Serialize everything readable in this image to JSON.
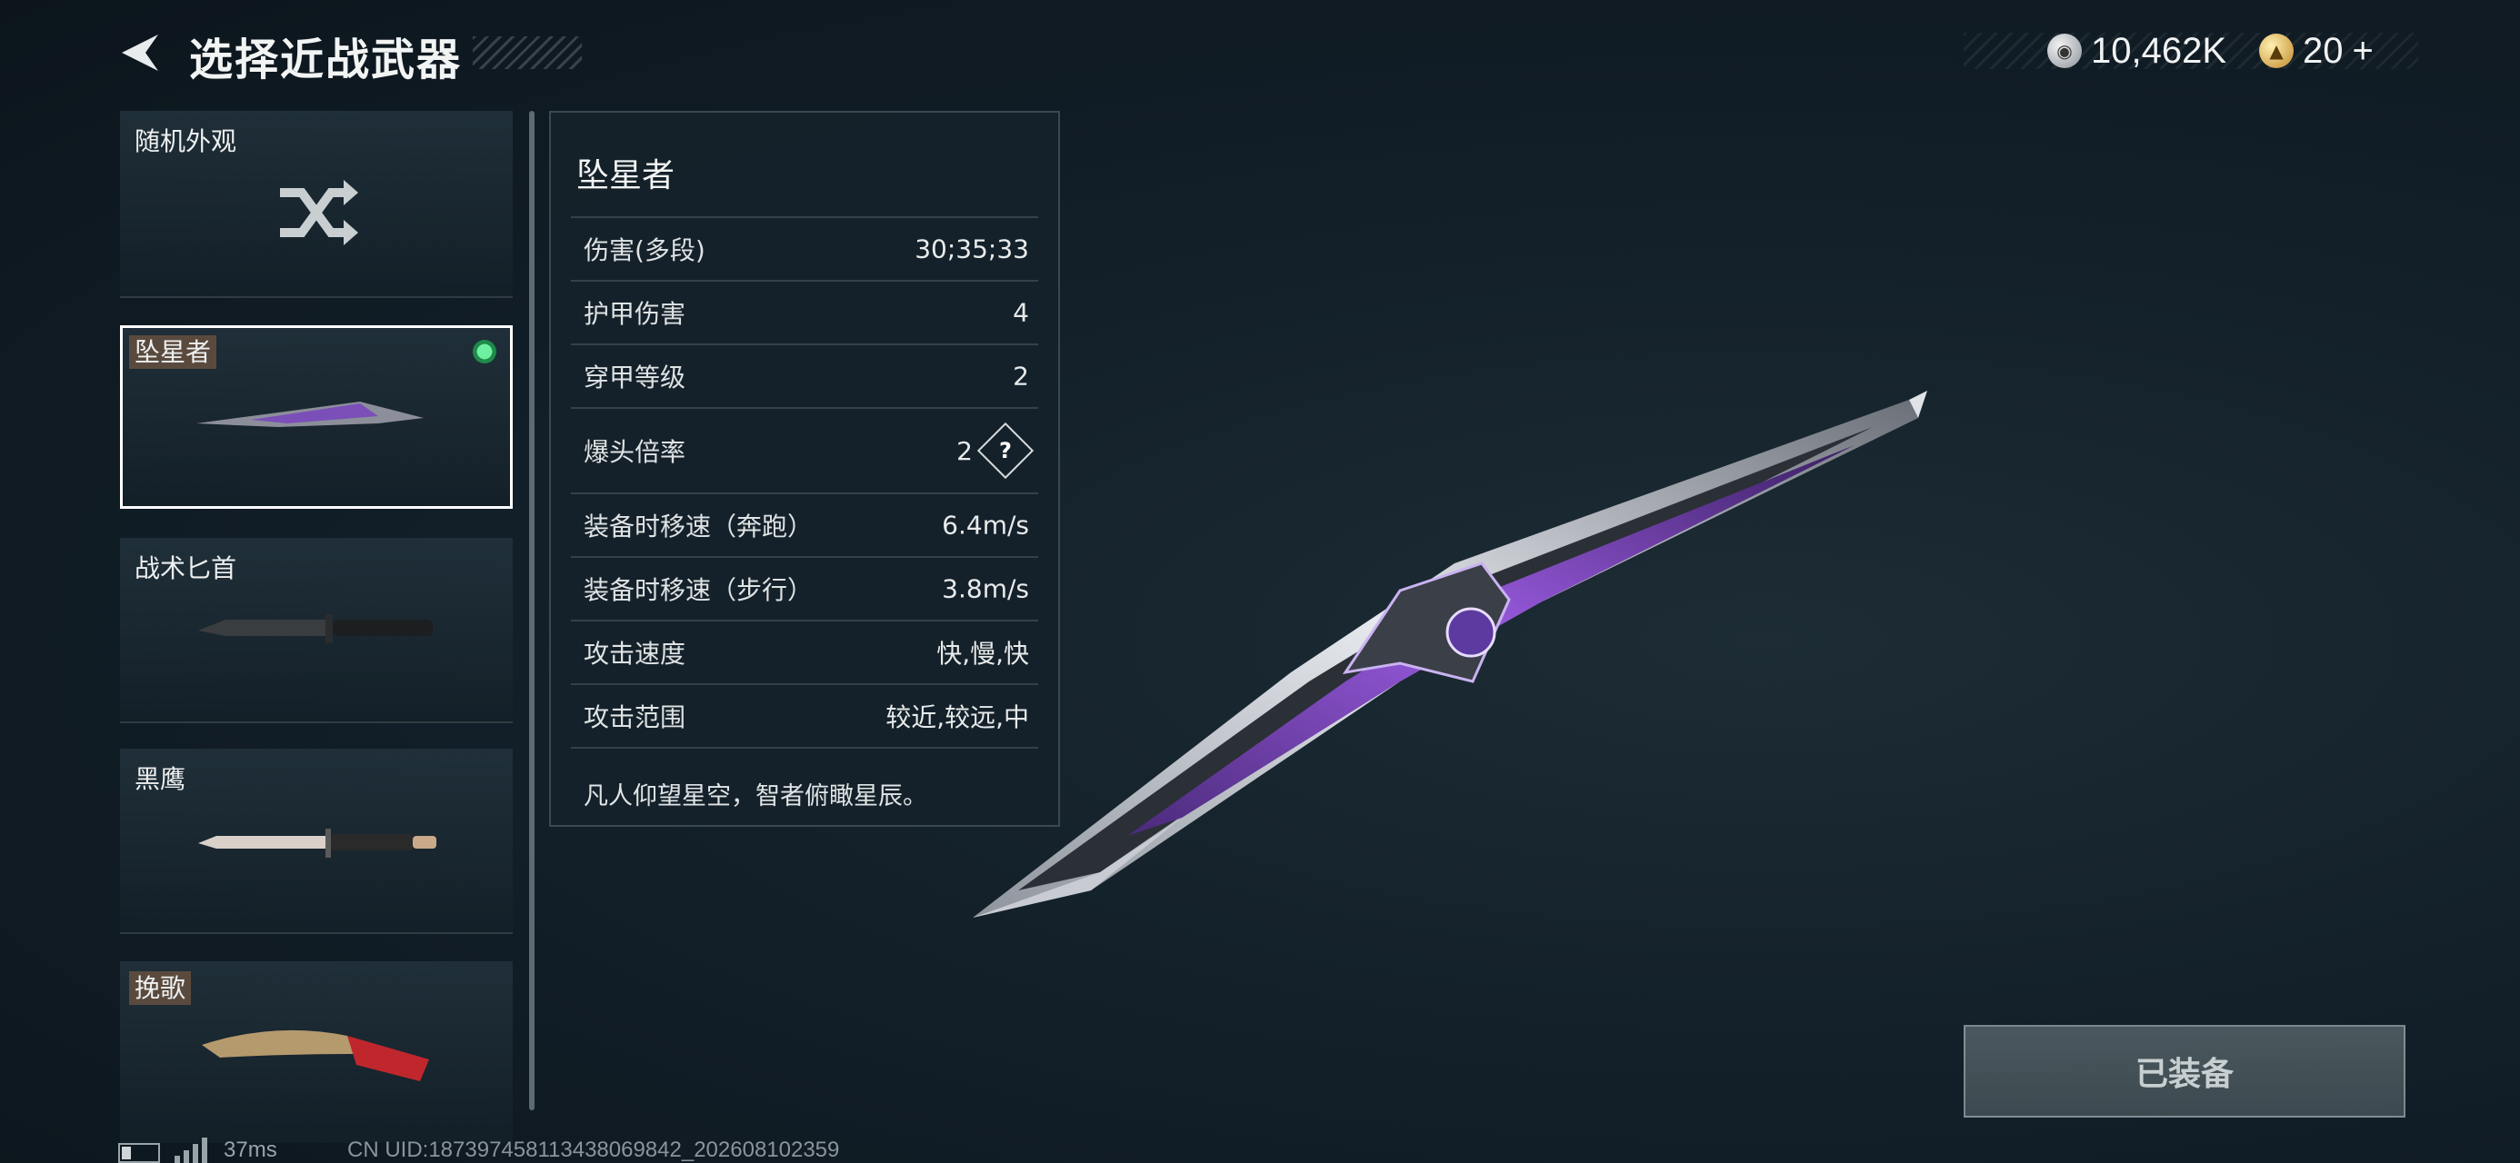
{
  "header": {
    "title": "选择近战武器",
    "back_icon": "back-arrow-icon"
  },
  "currency": {
    "silver": "10,462K",
    "gold": "20",
    "gold_add": "+"
  },
  "list": {
    "items": [
      {
        "label": "随机外观",
        "icon": "shuffle-icon"
      },
      {
        "label": "坠星者",
        "selected": true,
        "equipped": true
      },
      {
        "label": "战术匕首"
      },
      {
        "label": "黑鹰"
      },
      {
        "label": "挽歌"
      }
    ]
  },
  "panel": {
    "title": "坠星者",
    "stats": [
      {
        "k": "伤害(多段)",
        "v": "30;35;33"
      },
      {
        "k": "护甲伤害",
        "v": "4"
      },
      {
        "k": "穿甲等级",
        "v": "2"
      },
      {
        "k": "爆头倍率",
        "v": "2"
      },
      {
        "k": "装备时移速（奔跑）",
        "v": "6.4m/s"
      },
      {
        "k": "装备时移速（步行）",
        "v": "3.8m/s"
      },
      {
        "k": "攻击速度",
        "v": "快,慢,快"
      },
      {
        "k": "攻击范围",
        "v": "较近,较远,中"
      }
    ],
    "quote": "凡人仰望星空，智者俯瞰星辰。"
  },
  "equip_button": {
    "label": "已装备"
  },
  "footer": {
    "ping": "37ms",
    "uid": "CN UID:1873974581134380698​42_202608102359"
  },
  "colors": {
    "accent_green": "#3fd07a",
    "blade_purple": "#7a3fc0"
  }
}
